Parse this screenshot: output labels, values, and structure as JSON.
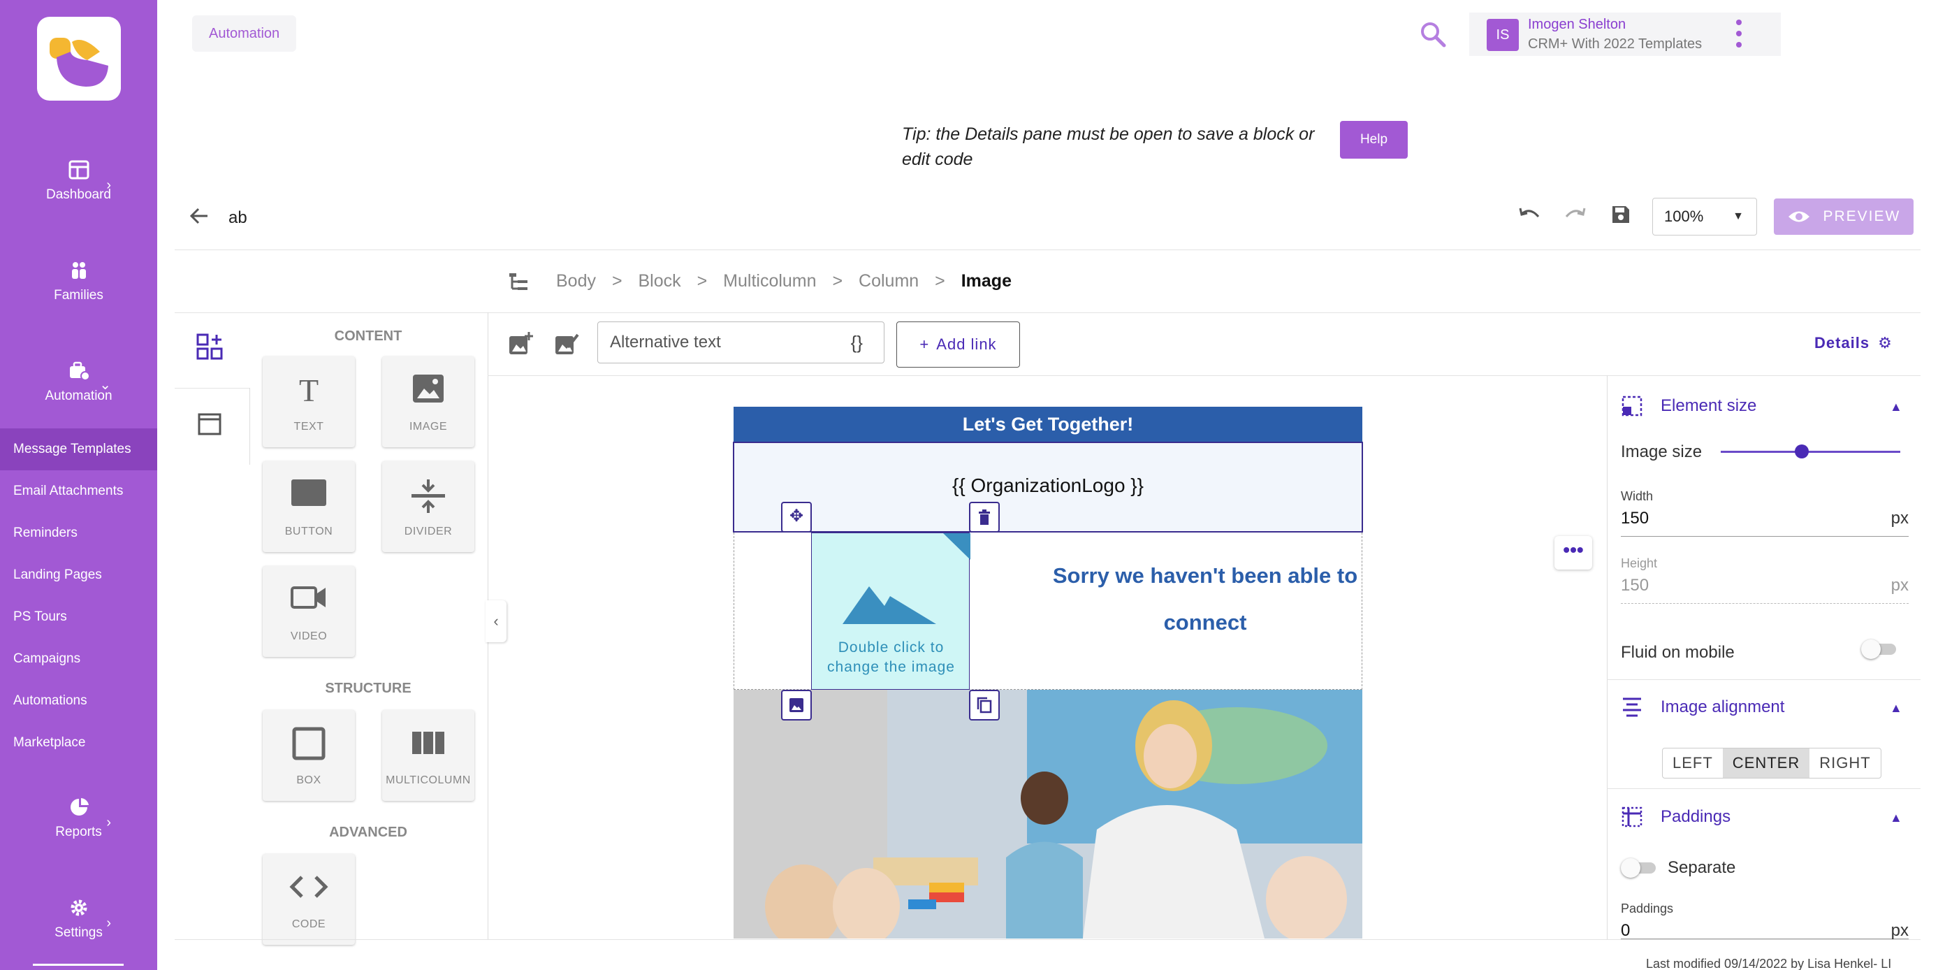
{
  "sidebar": {
    "nav": [
      {
        "label": "Dashboard"
      },
      {
        "label": "Families"
      },
      {
        "label": "Automation"
      },
      {
        "label": "Reports"
      },
      {
        "label": "Settings"
      }
    ],
    "submenu": [
      {
        "label": "Message Templates"
      },
      {
        "label": "Email Attachments"
      },
      {
        "label": "Reminders"
      },
      {
        "label": "Landing Pages"
      },
      {
        "label": "PS Tours"
      },
      {
        "label": "Campaigns"
      },
      {
        "label": "Automations"
      },
      {
        "label": "Marketplace"
      }
    ]
  },
  "topbar": {
    "breadcrumb": "Automation",
    "user": {
      "initials": "IS",
      "name": "Imogen Shelton",
      "subtitle": "CRM+ With 2022 Templates"
    }
  },
  "tip": {
    "text": "Tip: the Details pane must be open to save a block or edit code",
    "help_label": "Help"
  },
  "editor": {
    "doc_name": "ab",
    "zoom": "100%",
    "preview_label": "PREVIEW",
    "breadcrumb": [
      "Body",
      "Block",
      "Multicolumn",
      "Column",
      "Image"
    ],
    "breadcrumb_sep": ">",
    "alt_text_placeholder": "Alternative text",
    "braces": "{}",
    "add_link_label": "Add link",
    "details_label": "Details"
  },
  "blocks": {
    "content_title": "CONTENT",
    "content": [
      "TEXT",
      "IMAGE",
      "BUTTON",
      "DIVIDER",
      "VIDEO"
    ],
    "structure_title": "STRUCTURE",
    "structure": [
      "BOX",
      "MULTICOLUMN"
    ],
    "advanced_title": "ADVANCED",
    "advanced": [
      "CODE"
    ]
  },
  "email": {
    "header": "Let's Get Together!",
    "logo_placeholder": "{{ OrganizationLogo }}",
    "image_caption": "Double click to change the image",
    "message": "Sorry we haven't been able to connect"
  },
  "details_panel": {
    "element_size": {
      "title": "Element size",
      "image_size_label": "Image size",
      "image_size": 0.45,
      "width_label": "Width",
      "width": "150",
      "height_label": "Height",
      "height": "150",
      "unit": "px",
      "fluid_label": "Fluid on mobile"
    },
    "alignment": {
      "title": "Image alignment",
      "options": [
        "LEFT",
        "CENTER",
        "RIGHT"
      ],
      "selected": "CENTER"
    },
    "paddings": {
      "title": "Paddings",
      "separate_label": "Separate",
      "paddings_label": "Paddings",
      "value": "0",
      "unit": "px"
    }
  },
  "footer": {
    "text": "Last modified 09/14/2022 by Lisa Henkel- LI"
  },
  "colors": {
    "brand": "#a259d4",
    "email_header": "#2b5eaa",
    "accent": "#4a2ab5"
  }
}
